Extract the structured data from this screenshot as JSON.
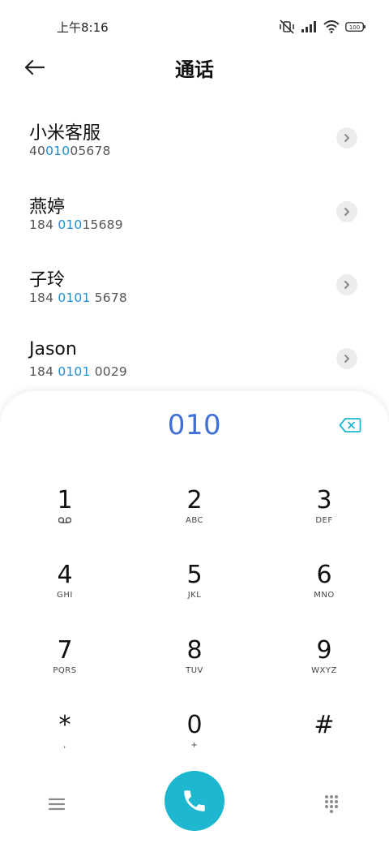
{
  "status_bar": {
    "time": "上午8:16",
    "battery": "100"
  },
  "header": {
    "title": "通话"
  },
  "results": [
    {
      "name": "小米客服",
      "number_pre": "40",
      "number_hl": "010",
      "number_post": "05678"
    },
    {
      "name": "燕婷",
      "number_pre": "184 ",
      "number_hl": "010",
      "number_post": "15689"
    },
    {
      "name": "子玲",
      "number_pre": "184 ",
      "number_hl": "0101",
      "number_post": " 5678"
    },
    {
      "name": "Jason",
      "number_pre": "184 ",
      "number_hl": "0101",
      "number_post": " 0029"
    }
  ],
  "dialpad": {
    "dialed": "010",
    "keys": [
      {
        "digit": "1",
        "letters": "voicemail-icon"
      },
      {
        "digit": "2",
        "letters": "ABC"
      },
      {
        "digit": "3",
        "letters": "DEF"
      },
      {
        "digit": "4",
        "letters": "GHI"
      },
      {
        "digit": "5",
        "letters": "JKL"
      },
      {
        "digit": "6",
        "letters": "MNO"
      },
      {
        "digit": "7",
        "letters": "PQRS"
      },
      {
        "digit": "8",
        "letters": "TUV"
      },
      {
        "digit": "9",
        "letters": "WXYZ"
      },
      {
        "digit": "*",
        "letters": ","
      },
      {
        "digit": "0",
        "letters": "+"
      },
      {
        "digit": "#",
        "letters": ""
      }
    ]
  },
  "colors": {
    "accent": "#3f6fd8",
    "highlight": "#1a8fd6",
    "call": "#1db7cf"
  }
}
